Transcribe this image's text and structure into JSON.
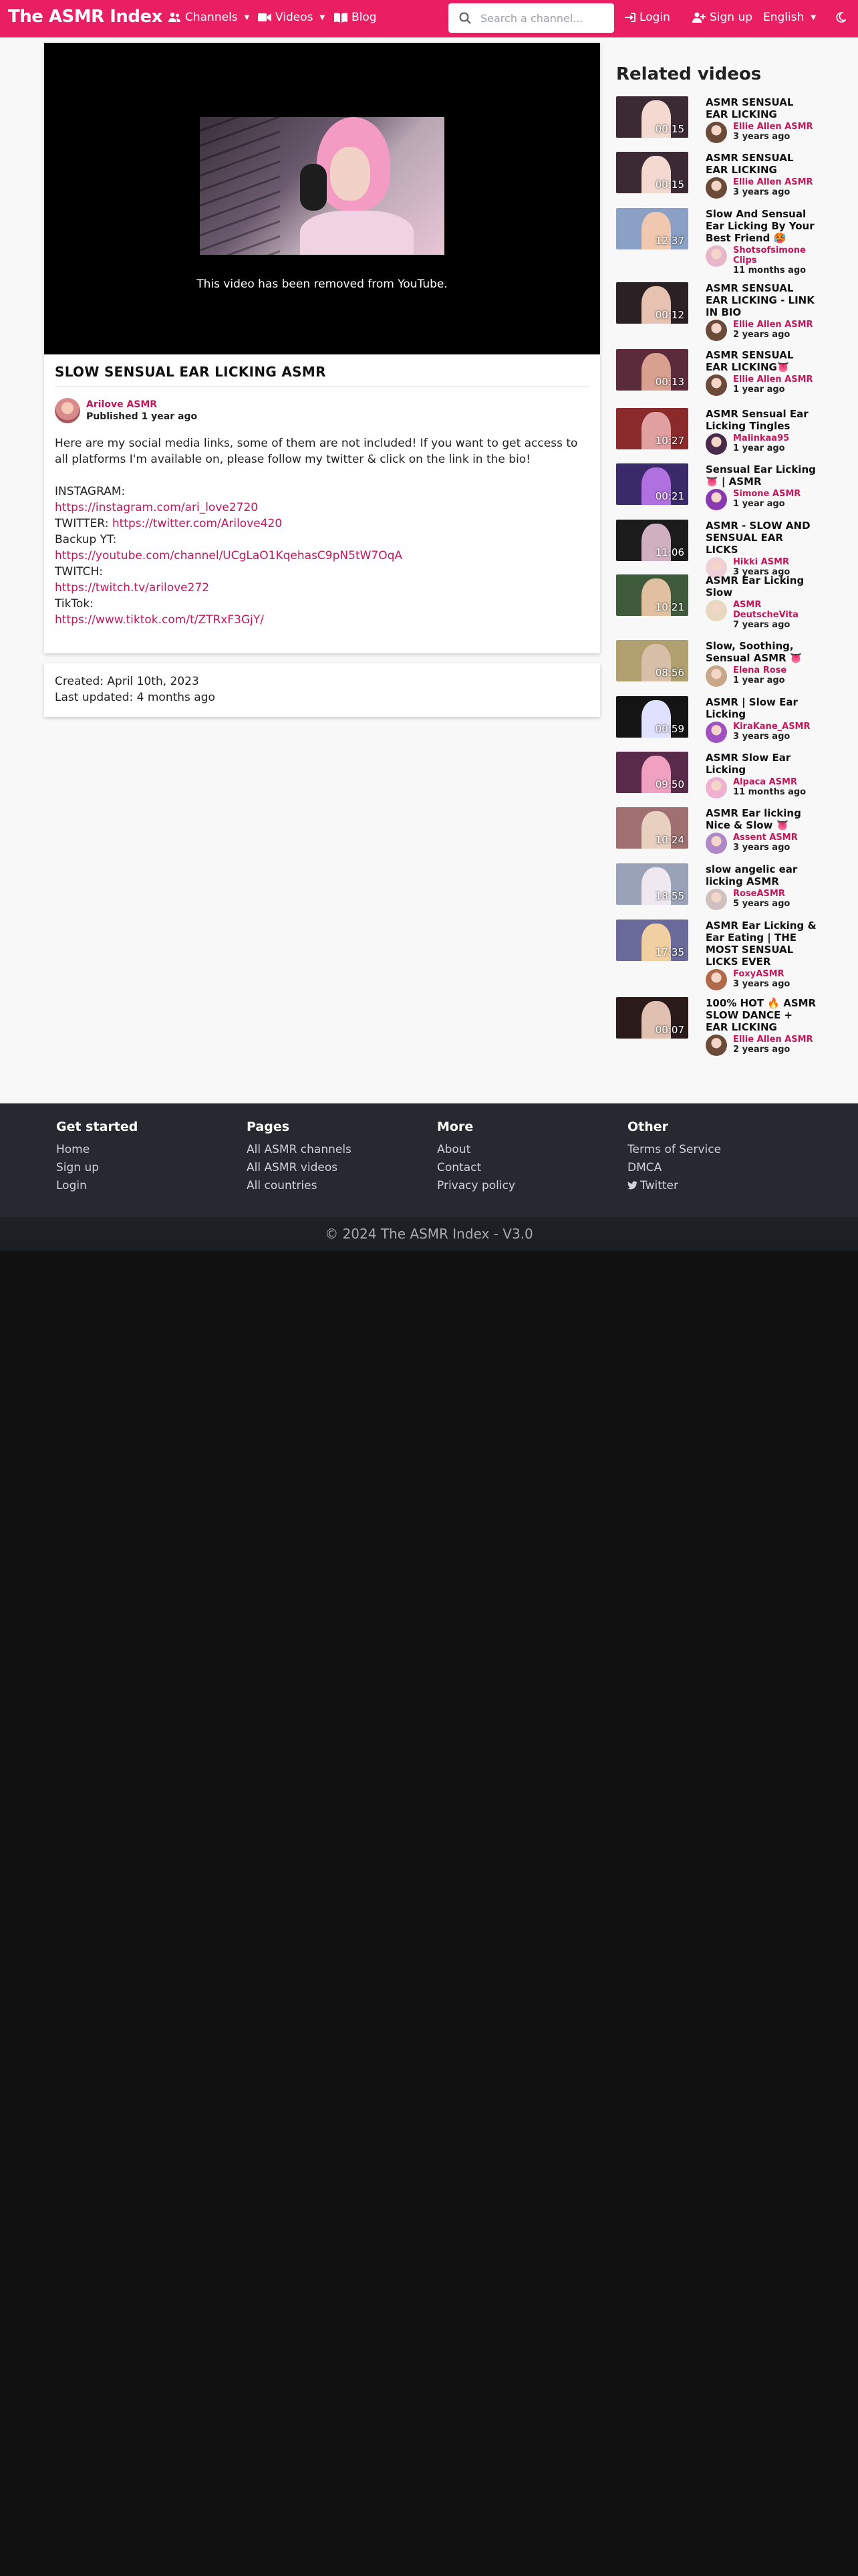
{
  "nav": {
    "brand": "The ASMR Index",
    "channels": "Channels",
    "videos": "Videos",
    "blog": "Blog",
    "search_placeholder": "Search a channel...",
    "login": "Login",
    "signup": "Sign up",
    "language": "English"
  },
  "video": {
    "removed_message": "This video has been removed from YouTube.",
    "title": "SLOW SENSUAL EAR LICKING ASMR",
    "author": "Arilove ASMR",
    "published": "Published 1 year ago",
    "desc_intro": "Here are my social media links, some of them are not included! If you want to get access to all platforms I'm available on, please follow my twitter & click on the link in the bio!",
    "instagram_label": "INSTAGRAM:",
    "instagram_url": "https://instagram.com/ari_love2720",
    "twitter_label": "TWITTER: ",
    "twitter_url": "https://twitter.com/Arilove420",
    "backup_label": "Backup YT:",
    "backup_url": "https://youtube.com/channel/UCgLaO1KqehasC9pN5tW7OqA",
    "twitch_label": "TWITCH:",
    "twitch_url": "https://twitch.tv/arilove272",
    "tiktok_label": "TikTok:",
    "tiktok_url": "https://www.tiktok.com/t/ZTRxF3GjY/"
  },
  "meta": {
    "created": "Created: April 10th, 2023",
    "updated": "Last updated: 4 months ago"
  },
  "related": {
    "heading": "Related videos",
    "items": [
      {
        "title": "ASMR SENSUAL EAR LICKING",
        "duration": "00:15",
        "channel": "Ellie Allen ASMR",
        "time": "3 years ago"
      },
      {
        "title": "ASMR SENSUAL EAR LICKING",
        "duration": "00:15",
        "channel": "Ellie Allen ASMR",
        "time": "3 years ago"
      },
      {
        "title": "Slow And Sensual Ear Licking By Your Best Friend 🥵",
        "duration": "12:37",
        "channel": "Shotsofsimone Clips",
        "time": "11 months ago"
      },
      {
        "title": "ASMR SENSUAL EAR LICKING - LINK IN BIO",
        "duration": "00:12",
        "channel": "Ellie Allen ASMR",
        "time": "2 years ago"
      },
      {
        "title": "ASMR SENSUAL EAR LICKING👅",
        "duration": "00:13",
        "channel": "Ellie Allen ASMR",
        "time": "1 year ago"
      },
      {
        "title": "ASMR Sensual Ear Licking Tingles",
        "duration": "10:27",
        "channel": "Malinkaa95",
        "time": "1 year ago"
      },
      {
        "title": "Sensual Ear Licking 👅 | ASMR",
        "duration": "00:21",
        "channel": "Simone ASMR",
        "time": "1 year ago"
      },
      {
        "title": "ASMR - SLOW AND SENSUAL EAR LICKS",
        "duration": "11:06",
        "channel": "Hikki ASMR",
        "time": "3 years ago"
      },
      {
        "title": "ASMR Ear Licking Slow",
        "duration": "10:21",
        "channel": "ASMR DeutscheVita",
        "time": "7 years ago"
      },
      {
        "title": "Slow, Soothing, Sensual ASMR 👅",
        "duration": "08:56",
        "channel": "Elena Rose",
        "time": "1 year ago"
      },
      {
        "title": "ASMR | Slow Ear Licking",
        "duration": "00:59",
        "channel": "KiraKane_ASMR",
        "time": "3 years ago"
      },
      {
        "title": "ASMR Slow Ear Licking",
        "duration": "09:50",
        "channel": "Alpaca ASMR",
        "time": "11 months ago"
      },
      {
        "title": "ASMR Ear licking Nice & Slow 👅",
        "duration": "10:24",
        "channel": "Assent ASMR",
        "time": "3 years ago"
      },
      {
        "title": "slow angelic ear licking ASMR",
        "duration": "18:55",
        "channel": "RoseASMR",
        "time": "5 years ago"
      },
      {
        "title": "ASMR Ear Licking & Ear Eating | THE MOST SENSUAL LICKS EVER",
        "duration": "17:35",
        "channel": "FoxyASMR",
        "time": "3 years ago"
      },
      {
        "title": "100% HOT 🔥 ASMR SLOW DANCE + EAR LICKING",
        "duration": "00:07",
        "channel": "Ellie Allen ASMR",
        "time": "2 years ago"
      }
    ]
  },
  "footer": {
    "col1": {
      "heading": "Get started",
      "links": [
        "Home",
        "Sign up",
        "Login"
      ]
    },
    "col2": {
      "heading": "Pages",
      "links": [
        "All ASMR channels",
        "All ASMR videos",
        "All countries"
      ]
    },
    "col3": {
      "heading": "More",
      "links": [
        "About",
        "Contact",
        "Privacy policy"
      ]
    },
    "col4": {
      "heading": "Other",
      "links": [
        "Terms of Service",
        "DMCA",
        "Twitter"
      ]
    },
    "copyright": "© 2024 The ASMR Index - V3.0"
  }
}
